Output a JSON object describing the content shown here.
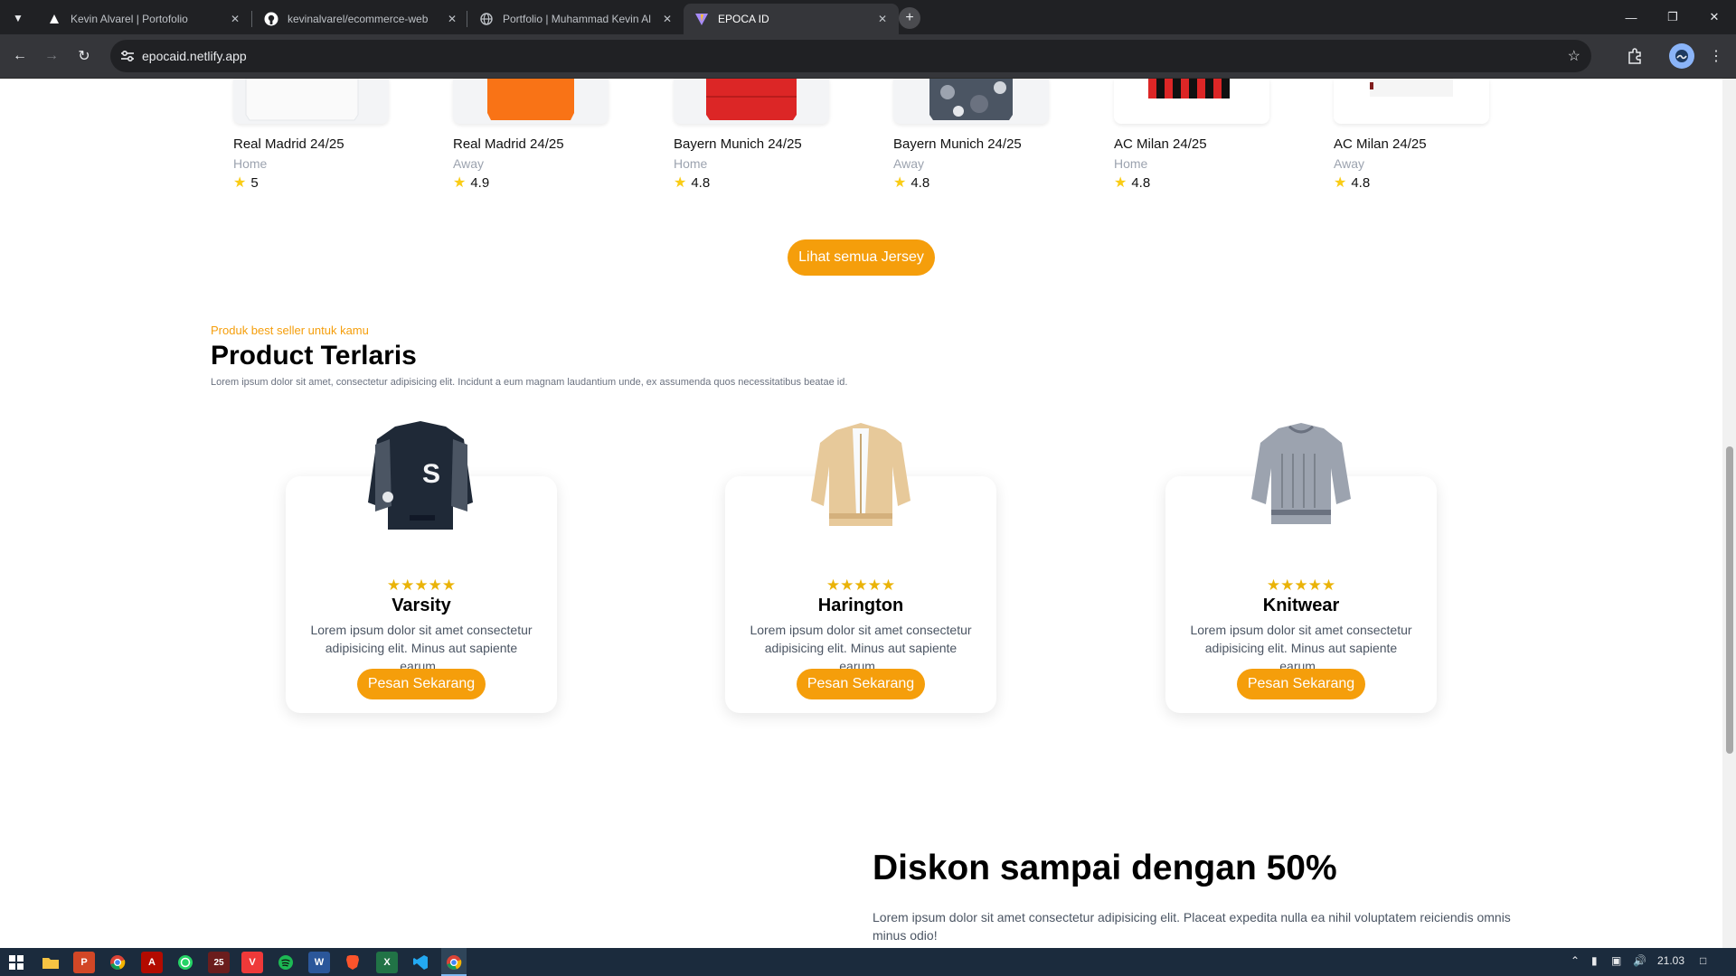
{
  "browser": {
    "tabs": [
      {
        "title": "Kevin Alvarel | Portofolio",
        "icon": "triangle-logo-icon"
      },
      {
        "title": "kevinalvarel/ecommerce-web",
        "icon": "github-icon"
      },
      {
        "title": "Portfolio | Muhammad Kevin Al",
        "icon": "globe-icon"
      },
      {
        "title": "EPOCA ID",
        "icon": "vite-logo-icon",
        "active": true
      }
    ],
    "url": "epocaid.netlify.app"
  },
  "jerseys": [
    {
      "name": "Real Madrid 24/25",
      "variant": "Home",
      "rating": "5"
    },
    {
      "name": "Real Madrid 24/25",
      "variant": "Away",
      "rating": "4.9"
    },
    {
      "name": "Bayern Munich 24/25",
      "variant": "Home",
      "rating": "4.8"
    },
    {
      "name": "Bayern Munich 24/25",
      "variant": "Away",
      "rating": "4.8"
    },
    {
      "name": "AC Milan 24/25",
      "variant": "Home",
      "rating": "4.8"
    },
    {
      "name": "AC Milan 24/25",
      "variant": "Away",
      "rating": "4.8"
    }
  ],
  "see_all_label": "Lihat semua Jersey",
  "bestseller": {
    "kicker": "Produk best seller untuk kamu",
    "title": "Product Terlaris",
    "lead": "Lorem ipsum dolor sit amet, consectetur adipisicing elit. Incidunt a eum magnam laudantium unde, ex assumenda quos necessitatibus beatae id.",
    "stars": "★★★★★",
    "products": [
      {
        "name": "Varsity",
        "desc": "Lorem ipsum dolor sit amet consectetur adipisicing elit. Minus aut sapiente earum..",
        "button": "Pesan Sekarang"
      },
      {
        "name": "Harington",
        "desc": "Lorem ipsum dolor sit amet consectetur adipisicing elit. Minus aut sapiente earum..",
        "button": "Pesan Sekarang"
      },
      {
        "name": "Knitwear",
        "desc": "Lorem ipsum dolor sit amet consectetur adipisicing elit. Minus aut sapiente earum..",
        "button": "Pesan Sekarang"
      }
    ]
  },
  "promo": {
    "title": "Diskon sampai dengan 50%",
    "text": "Lorem ipsum dolor sit amet consectetur adipisicing elit. Placeat expedita nulla ea nihil voluptatem reiciendis omnis minus odio!"
  },
  "taskbar": {
    "clock": "21.03",
    "apps": [
      "windows-start-icon",
      "file-explorer-icon",
      "powerpoint-icon",
      "chrome-icon",
      "acrobat-icon",
      "whatsapp-icon",
      "25-app-icon",
      "vivaldi-icon",
      "spotify-icon",
      "word-icon",
      "brave-icon",
      "excel-icon",
      "vscode-icon",
      "chrome-active-icon"
    ]
  },
  "colors": {
    "accent": "#f59e0b",
    "star": "#facc15"
  }
}
